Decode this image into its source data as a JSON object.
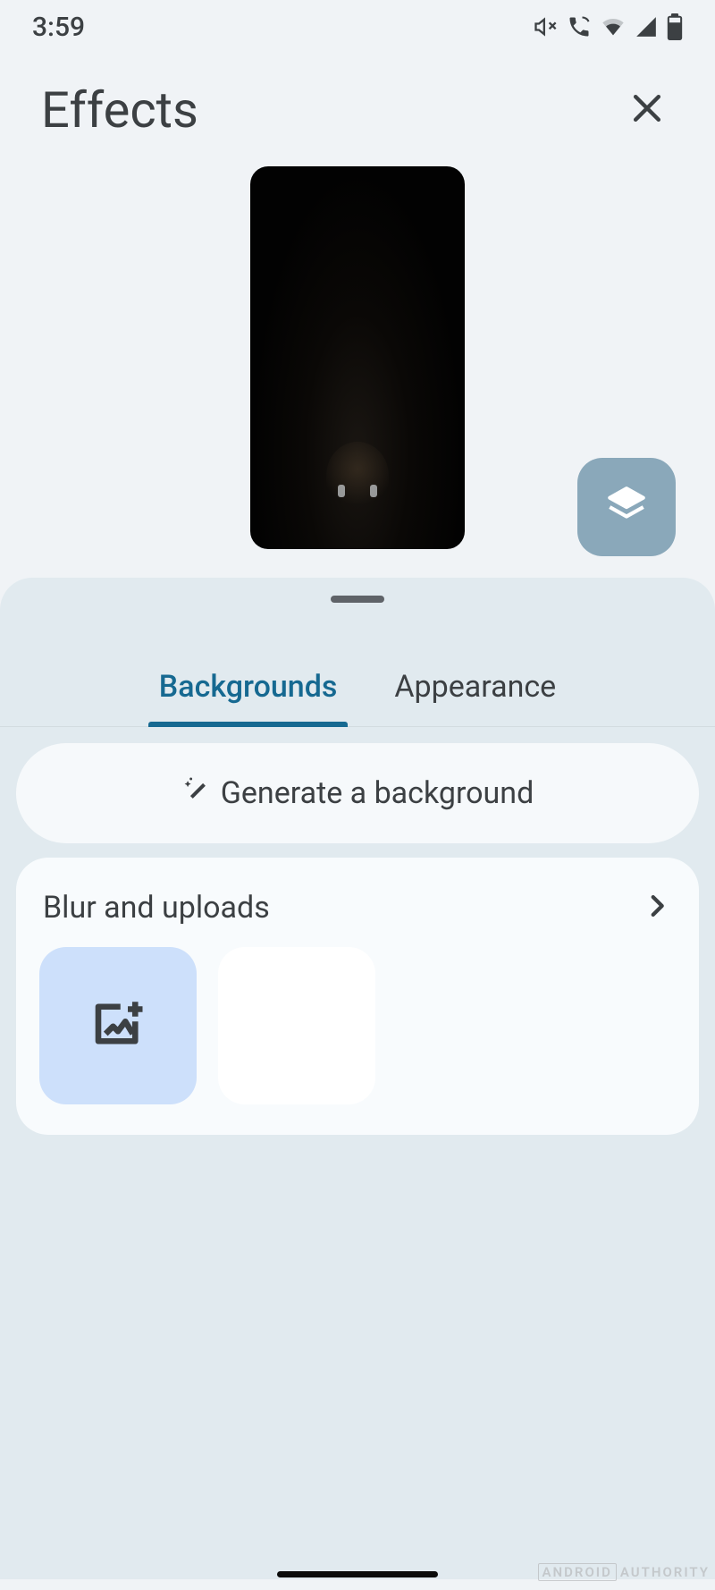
{
  "status": {
    "time": "3:59"
  },
  "header": {
    "title": "Effects"
  },
  "tabs": {
    "items": [
      {
        "label": "Backgrounds",
        "active": true
      },
      {
        "label": "Appearance",
        "active": false
      }
    ]
  },
  "generate": {
    "label": "Generate a background"
  },
  "section": {
    "title": "Blur and uploads"
  },
  "watermark": {
    "brand": "ANDROID",
    "suffix": "AUTHORITY"
  }
}
